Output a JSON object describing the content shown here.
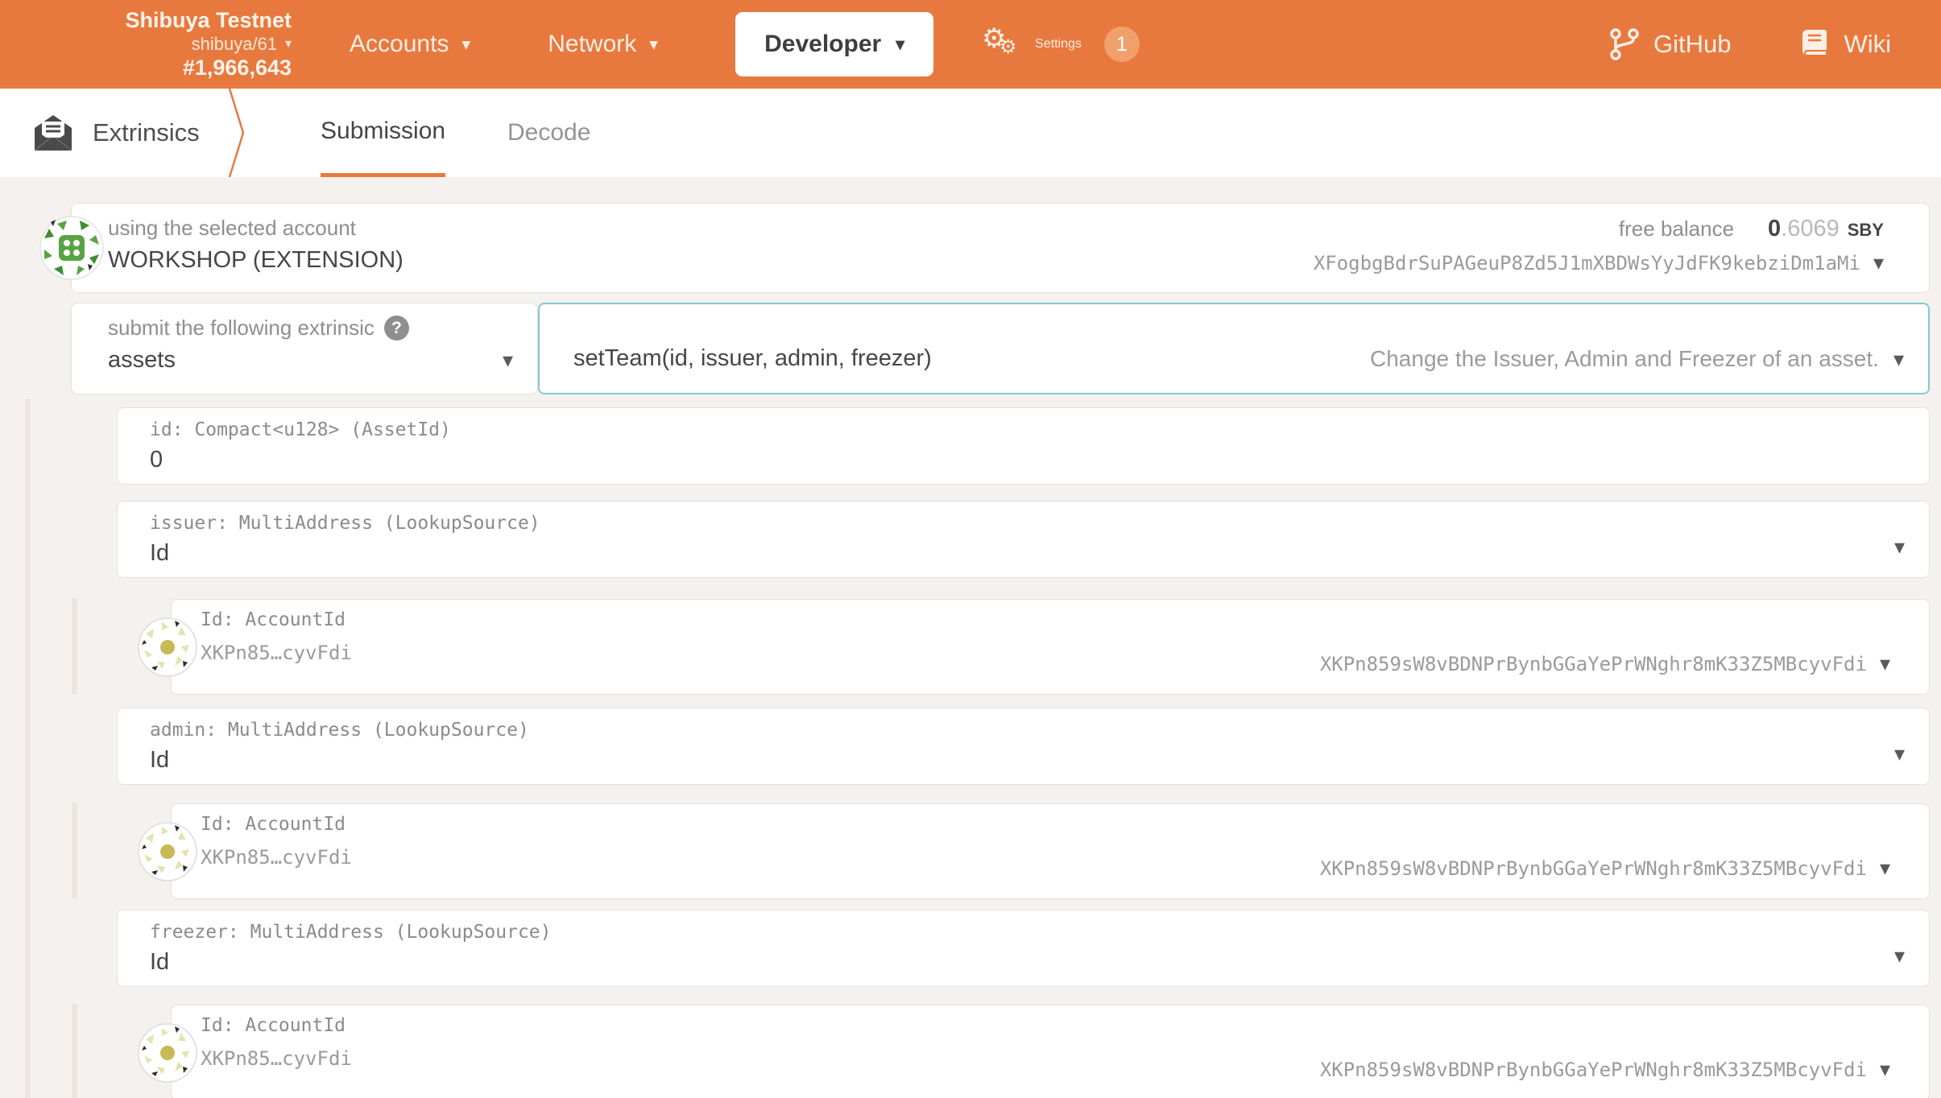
{
  "colors": {
    "accent": "#e8793e",
    "focus_border": "#84c8d9",
    "badge": "#f2a06b",
    "page_bg": "#f4f1ee"
  },
  "icons": {
    "caret": "▾",
    "gears": "⚙",
    "question": "?"
  },
  "header": {
    "chain": {
      "name": "Shibuya Testnet",
      "spec": "shibuya/61",
      "block": "#1,966,643"
    },
    "nav": {
      "accounts": "Accounts",
      "network": "Network",
      "developer": "Developer",
      "settings": "Settings",
      "settings_badge": "1"
    },
    "links": {
      "github": "GitHub",
      "wiki": "Wiki"
    }
  },
  "tabbar": {
    "app": "Extrinsics",
    "tabs": [
      {
        "label": "Submission"
      },
      {
        "label": "Decode"
      }
    ]
  },
  "account": {
    "label": "using the selected account",
    "name": "WORKSHOP (EXTENSION)",
    "balance_label": "free balance",
    "balance_whole": "0",
    "balance_fraction": ".6069",
    "balance_unit": "SBY",
    "address": "XFogbgBdrSuPAGeuP8Zd5J1mXBDWsYyJdFK9kebziDm1aMi"
  },
  "extrinsic": {
    "label": "submit the following extrinsic",
    "pallet": "assets",
    "method": "setTeam(id, issuer, admin, freezer)",
    "description": "Change the Issuer, Admin and Freezer of an asset."
  },
  "params": {
    "id": {
      "label": "id: Compact<u128> (AssetId)",
      "value": "0"
    },
    "issuer": {
      "label": "issuer: MultiAddress (LookupSource)",
      "value": "Id"
    },
    "issuer_account": {
      "label": "Id: AccountId",
      "short": "XKPn85…cyvFdi",
      "address": "XKPn859sW8vBDNPrBynbGGaYePrWNghr8mK33Z5MBcyvFdi"
    },
    "admin": {
      "label": "admin: MultiAddress (LookupSource)",
      "value": "Id"
    },
    "admin_account": {
      "label": "Id: AccountId",
      "short": "XKPn85…cyvFdi",
      "address": "XKPn859sW8vBDNPrBynbGGaYePrWNghr8mK33Z5MBcyvFdi"
    },
    "freezer": {
      "label": "freezer: MultiAddress (LookupSource)",
      "value": "Id"
    },
    "freezer_account": {
      "label": "Id: AccountId",
      "short": "XKPn85…cyvFdi",
      "address": "XKPn859sW8vBDNPrBynbGGaYePrWNghr8mK33Z5MBcyvFdi"
    }
  }
}
